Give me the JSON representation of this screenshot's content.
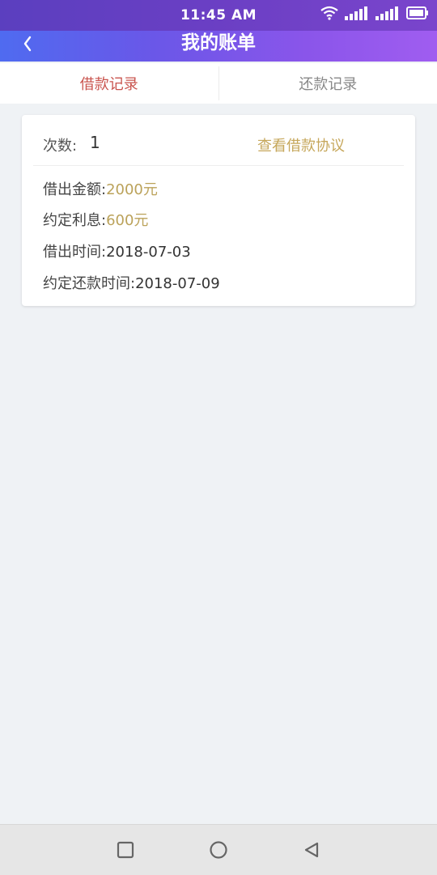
{
  "status_bar": {
    "time": "11:45 AM",
    "icons": [
      "wifi-icon",
      "signal-icon",
      "signal-icon",
      "battery-icon"
    ]
  },
  "header": {
    "title": "我的账单",
    "back_icon": "chevron-left-icon"
  },
  "tabs": [
    {
      "label": "借款记录",
      "active": true
    },
    {
      "label": "还款记录",
      "active": false
    }
  ],
  "record": {
    "count_label": "次数:",
    "count_value": "1",
    "agreement_link": "查看借款协议",
    "amount_label": "借出金额:",
    "amount_value": "2000元",
    "interest_label": "约定利息:",
    "interest_value": "600元",
    "lend_date_label": "借出时间:",
    "lend_date_value": "2018-07-03",
    "repay_date_label": "约定还款时间:",
    "repay_date_value": "2018-07-09"
  },
  "colors": {
    "accent_active_tab": "#c9544e",
    "gold_value": "#bba25a",
    "header_gradient_start": "#4f6bf0",
    "header_gradient_end": "#a05df0"
  },
  "nav_bar": {
    "icons": [
      "square-icon",
      "circle-icon",
      "triangle-back-icon"
    ]
  }
}
